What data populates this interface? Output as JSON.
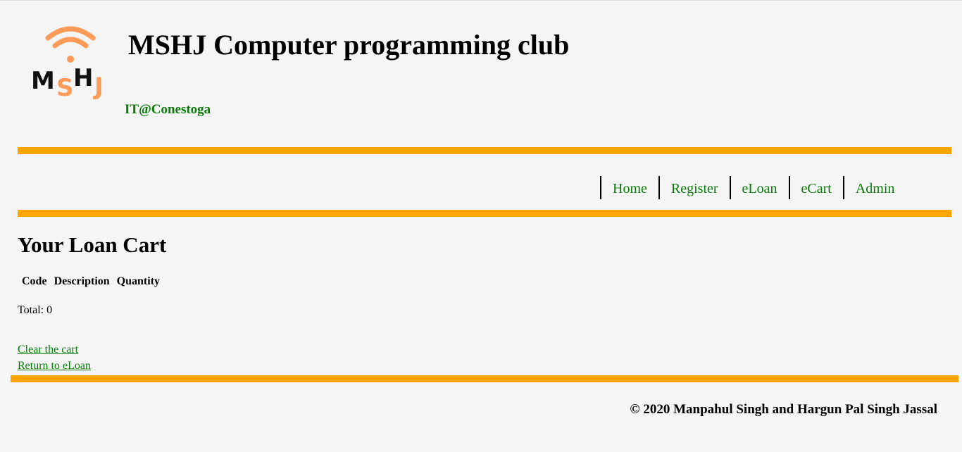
{
  "header": {
    "logo_text": "MSHJ",
    "title": "MSHJ Computer programming club",
    "subtitle": "IT@Conestoga"
  },
  "nav": {
    "items": [
      {
        "label": "Home"
      },
      {
        "label": "Register"
      },
      {
        "label": "eLoan"
      },
      {
        "label": "eCart"
      },
      {
        "label": "Admin"
      }
    ]
  },
  "main": {
    "heading": "Your Loan Cart",
    "table": {
      "columns": [
        "Code",
        "Description",
        "Quantity"
      ],
      "rows": []
    },
    "total_text": "Total: 0",
    "links": {
      "clear_cart": "Clear the cart",
      "return_eloan": "Return to eLoan"
    }
  },
  "footer": {
    "copyright": "© 2020 Manpahul Singh and Hargun Pal Singh Jassal"
  },
  "colors": {
    "accent_bar": "#ffa500",
    "link_green": "#0a7a0a",
    "logo_orange": "#ff9a57",
    "background": "#f5f5f5"
  }
}
